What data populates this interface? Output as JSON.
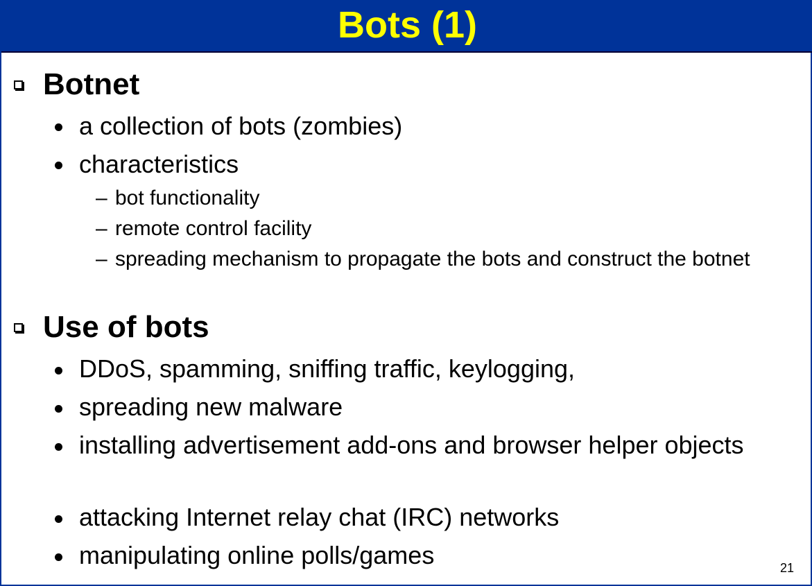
{
  "title": "Bots (1)",
  "sections": [
    {
      "heading": "Botnet",
      "items": [
        {
          "text": "a collection of bots (zombies)"
        },
        {
          "text": "characteristics",
          "subitems": [
            "bot functionality",
            "remote control facility",
            "spreading mechanism to propagate the bots and construct the botnet"
          ]
        }
      ]
    },
    {
      "heading": "Use of bots",
      "items": [
        {
          "text": "DDoS, spamming, sniffing traffic, keylogging,"
        },
        {
          "text": "spreading new malware"
        },
        {
          "text": "installing advertisement add-ons and browser helper objects"
        },
        {
          "text": "attacking Internet relay chat (IRC) networks"
        },
        {
          "text": "manipulating online polls/games"
        }
      ]
    }
  ],
  "dash_glyph": "–",
  "page_number": "21",
  "colors": {
    "title_bar": "#003399",
    "title_text": "#ffff00",
    "body_text": "#000000"
  }
}
